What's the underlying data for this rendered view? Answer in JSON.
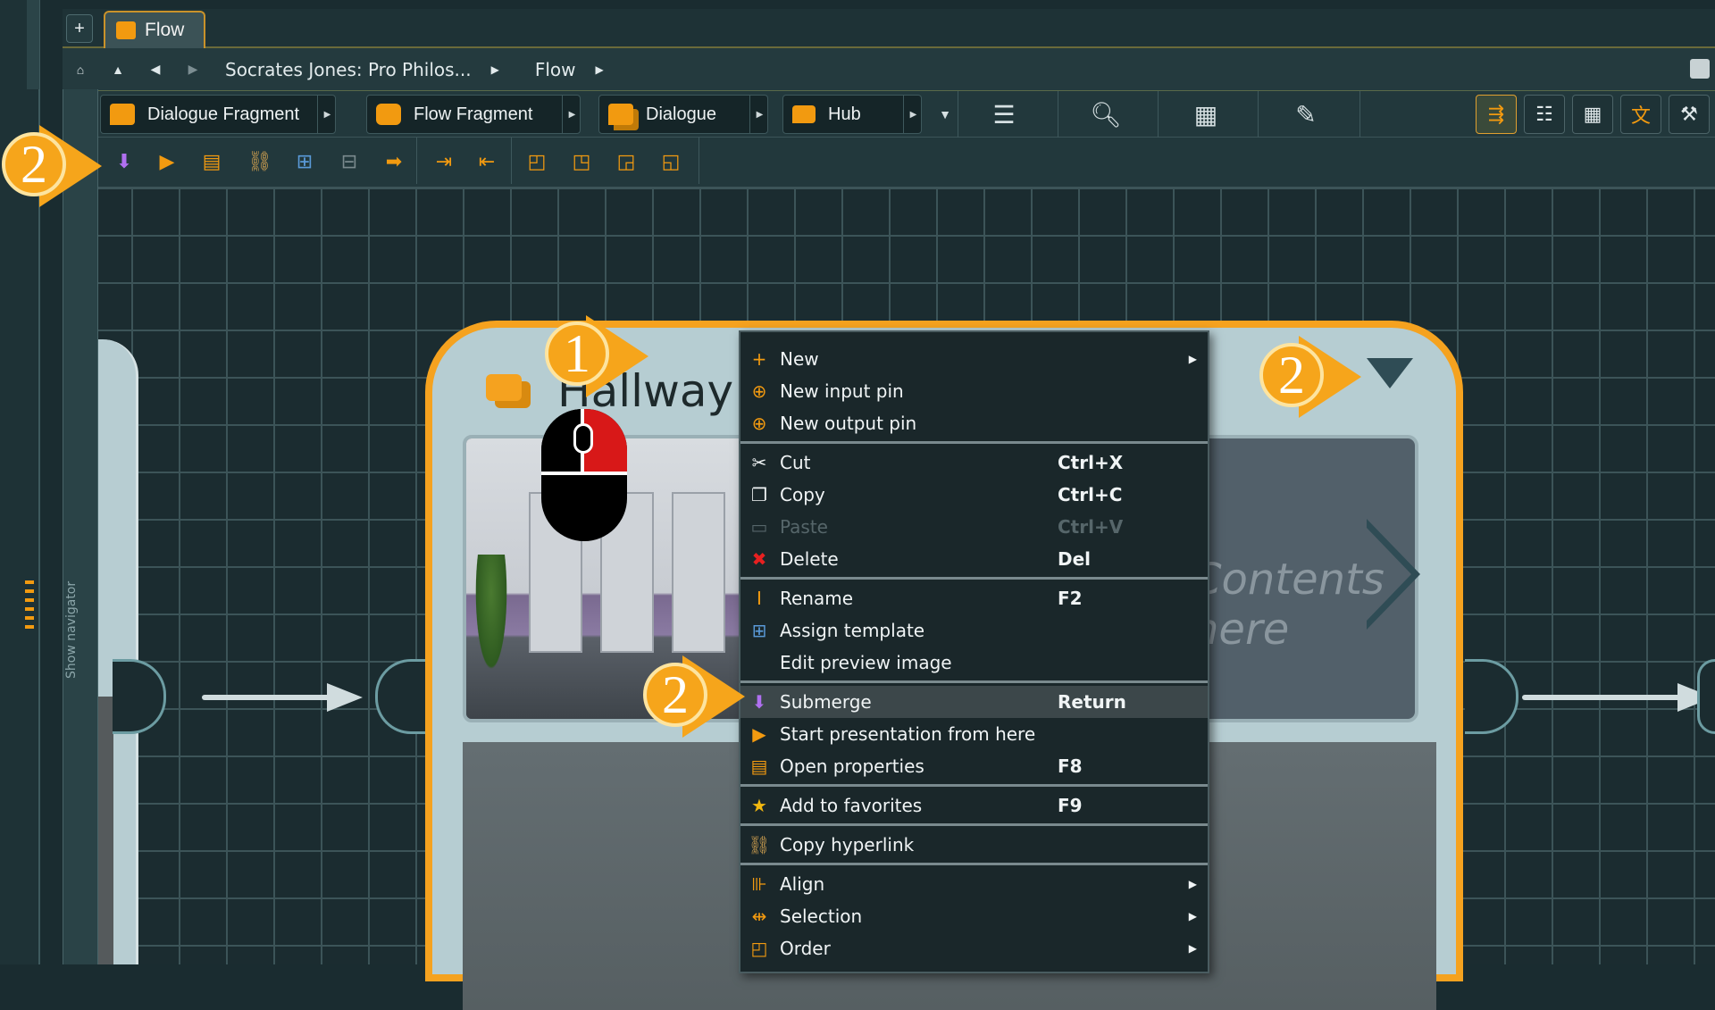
{
  "tabbar": {
    "add_label": "+",
    "active_tab": "Flow"
  },
  "breadcrumb": {
    "items": [
      "Socrates Jones: Pro Philos...",
      "Flow"
    ]
  },
  "toolbar": {
    "dialogue_fragment": "Dialogue Fragment",
    "flow_fragment": "Flow Fragment",
    "dialogue": "Dialogue",
    "hub": "Hub"
  },
  "sidebar": {
    "show_navigator": "Show navigator"
  },
  "node": {
    "title": "Hallway",
    "content_hint": "Contents here"
  },
  "context_menu": {
    "items": [
      {
        "label": "New",
        "shortcut": "",
        "submenu": true
      },
      {
        "label": "New input pin",
        "shortcut": ""
      },
      {
        "label": "New output pin",
        "shortcut": ""
      },
      {
        "label": "Cut",
        "shortcut": "Ctrl+X"
      },
      {
        "label": "Copy",
        "shortcut": "Ctrl+C"
      },
      {
        "label": "Paste",
        "shortcut": "Ctrl+V",
        "disabled": true
      },
      {
        "label": "Delete",
        "shortcut": "Del"
      },
      {
        "label": "Rename",
        "shortcut": "F2"
      },
      {
        "label": "Assign template",
        "shortcut": ""
      },
      {
        "label": "Edit preview image",
        "shortcut": ""
      },
      {
        "label": "Submerge",
        "shortcut": "Return",
        "highlighted": true
      },
      {
        "label": "Start presentation from here",
        "shortcut": ""
      },
      {
        "label": "Open properties",
        "shortcut": "F8"
      },
      {
        "label": "Add to favorites",
        "shortcut": "F9"
      },
      {
        "label": "Copy hyperlink",
        "shortcut": ""
      },
      {
        "label": "Align",
        "shortcut": "",
        "submenu": true
      },
      {
        "label": "Selection",
        "shortcut": "",
        "submenu": true
      },
      {
        "label": "Order",
        "shortcut": "",
        "submenu": true
      }
    ]
  },
  "annotations": {
    "step_one": "1",
    "step_two": "2"
  },
  "colors": {
    "accent": "#f5a21f",
    "node_bg": "#b6cdd2",
    "canvas": "#1b2c30",
    "menu_bg": "#1a272a"
  }
}
